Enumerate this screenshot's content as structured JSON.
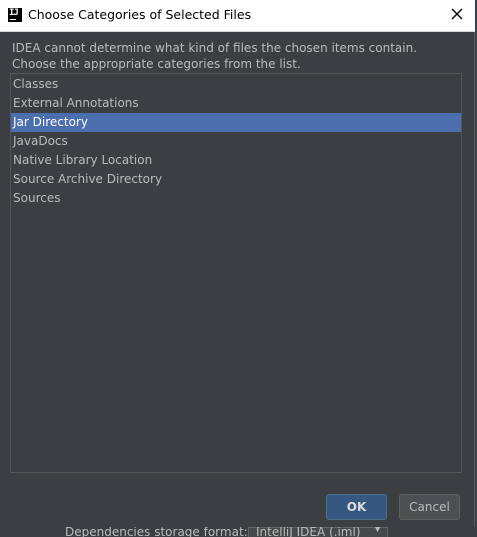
{
  "dialog": {
    "title": "Choose Categories of Selected Files",
    "app_icon_text": "IJ",
    "message_lines": [
      "IDEA cannot determine what kind of files the chosen items contain.",
      "Choose the appropriate categories from the list."
    ]
  },
  "categories": {
    "items": [
      {
        "label": "Classes",
        "selected": false
      },
      {
        "label": "External Annotations",
        "selected": false
      },
      {
        "label": "Jar Directory",
        "selected": true
      },
      {
        "label": "JavaDocs",
        "selected": false
      },
      {
        "label": "Native Library Location",
        "selected": false
      },
      {
        "label": "Source Archive Directory",
        "selected": false
      },
      {
        "label": "Sources",
        "selected": false
      }
    ]
  },
  "buttons": {
    "ok_label": "OK",
    "cancel_label": "Cancel"
  },
  "background_window": {
    "label": "Dependencies storage format:",
    "combo_value": "IntelliJ IDEA (.iml)"
  },
  "colors": {
    "dialog_bg": "#3c3f41",
    "selection": "#4b6eaf",
    "ok_button": "#365880",
    "text": "#bbbbbb"
  },
  "icons": {
    "title": "intellij-idea-icon",
    "close": "close-icon"
  }
}
